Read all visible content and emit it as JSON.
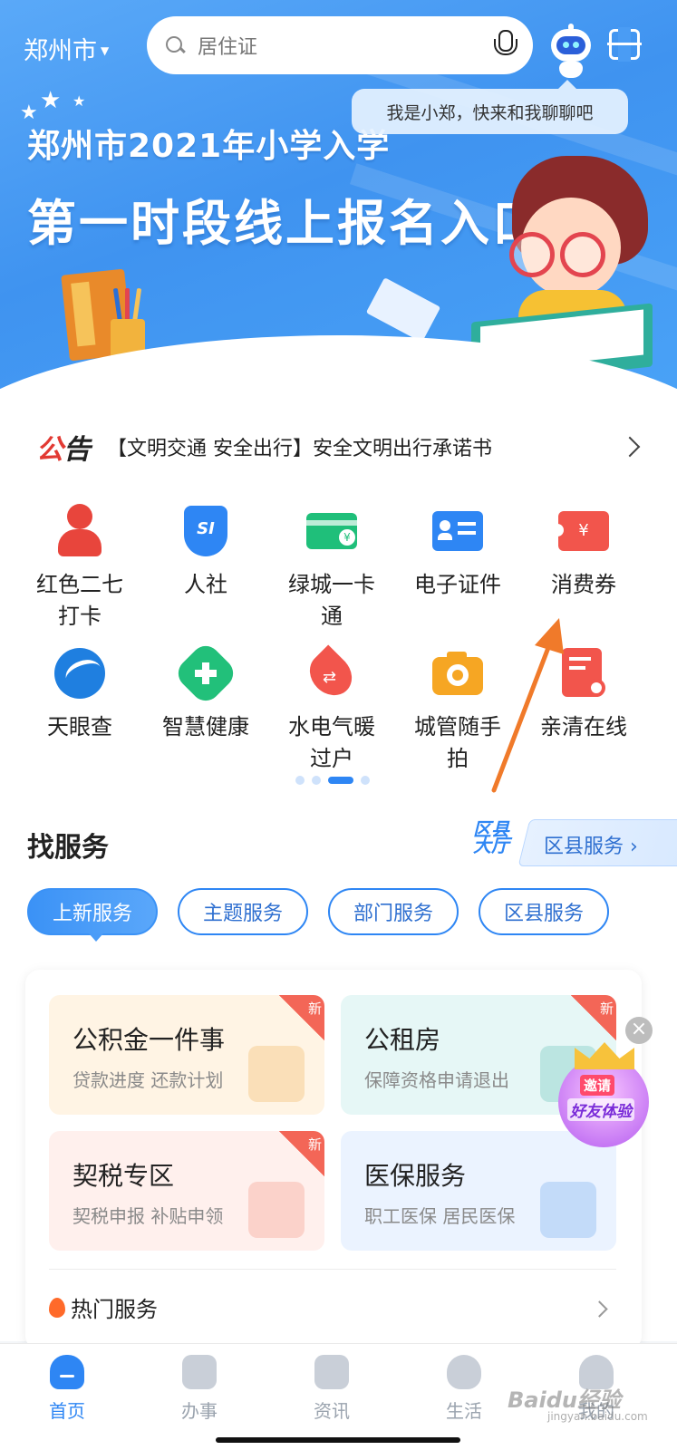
{
  "header": {
    "city": "郑州市",
    "search_placeholder": "居住证",
    "assistant_bubble": "我是小郑，快来和我聊聊吧"
  },
  "banner": {
    "title_line1": "郑州市2021年小学入学",
    "title_line2": "第一时段线上报名入口"
  },
  "notice": {
    "tag_part1": "公",
    "tag_part2": "告",
    "text": "【文明交通 安全出行】安全文明出行承诺书"
  },
  "grid": {
    "items": [
      {
        "label": "红色二七\n打卡",
        "icon": "person-red-icon",
        "color": "#e8453c"
      },
      {
        "label": "人社",
        "icon": "shield-si-icon",
        "color": "#2e86f4"
      },
      {
        "label": "绿城一卡\n通",
        "icon": "green-card-icon",
        "color": "#1fbf7a"
      },
      {
        "label": "电子证件",
        "icon": "id-card-icon",
        "color": "#2e86f4"
      },
      {
        "label": "消费券",
        "icon": "coupon-icon",
        "color": "#f2554c"
      },
      {
        "label": "天眼查",
        "icon": "tianyancha-icon",
        "color": "#1f7fe0"
      },
      {
        "label": "智慧健康",
        "icon": "health-cross-icon",
        "color": "#22c07a"
      },
      {
        "label": "水电气暖\n过户",
        "icon": "utilities-drop-icon",
        "color": "#f2554c"
      },
      {
        "label": "城管随手\n拍",
        "icon": "camera-icon",
        "color": "#f6a623"
      },
      {
        "label": "亲清在线",
        "icon": "certificate-icon",
        "color": "#f2554c"
      }
    ],
    "page_count": 4,
    "active_page": 3
  },
  "services": {
    "title": "找服务",
    "hall_label": "区县\n大厅",
    "county_link": "区县服务",
    "tabs": [
      "上新服务",
      "主题服务",
      "部门服务",
      "区县服务"
    ],
    "active_tab": 0,
    "cards": [
      {
        "title": "公积金一件事",
        "subtitle": "贷款进度 还款计划",
        "badge": "新",
        "bg": "#fff4e4",
        "deco": "#f6c98b"
      },
      {
        "title": "公租房",
        "subtitle": "保障资格申请退出",
        "badge": "新",
        "bg": "#e6f7f6",
        "deco": "#8fd4cc"
      },
      {
        "title": "契税专区",
        "subtitle": "契税申报 补贴申领",
        "badge": "新",
        "bg": "#fff0ed",
        "deco": "#f7b3a8"
      },
      {
        "title": "医保服务",
        "subtitle": "职工医保 居民医保",
        "badge": "",
        "bg": "#ebf3ff",
        "deco": "#9cc3f4"
      }
    ],
    "hot_label": "热门服务"
  },
  "invite": {
    "line1": "邀请",
    "line2": "好友体验",
    "close": "×"
  },
  "nav": {
    "items": [
      {
        "label": "首页",
        "icon": "home-icon"
      },
      {
        "label": "办事",
        "icon": "clock-icon"
      },
      {
        "label": "资讯",
        "icon": "news-icon"
      },
      {
        "label": "生活",
        "icon": "heart-icon"
      },
      {
        "label": "我的",
        "icon": "user-icon"
      }
    ],
    "active": 0
  },
  "watermark": {
    "text": "Baidu经验",
    "sub": "jingyan.baidu.com"
  },
  "colors": {
    "accent": "#2e86f4",
    "annotation_arrow": "#f07a2a"
  }
}
